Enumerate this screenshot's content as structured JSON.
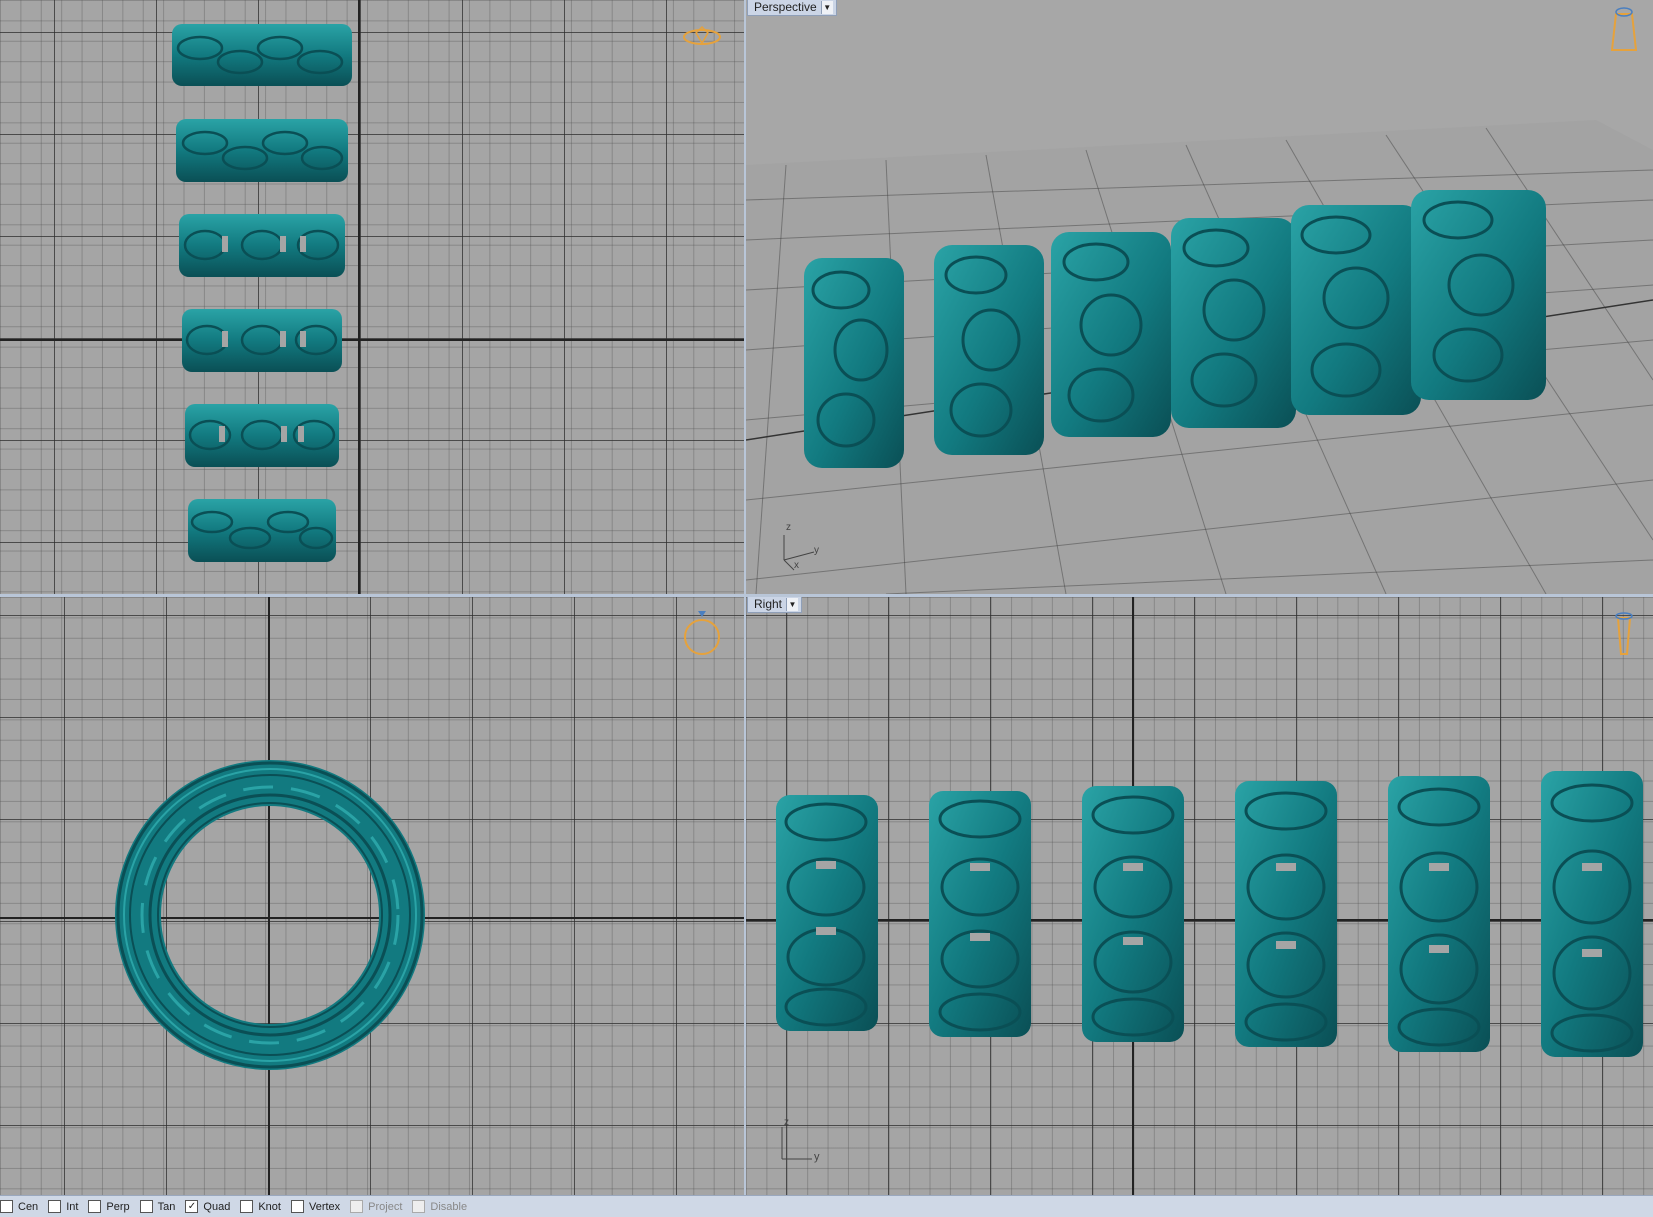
{
  "viewports": {
    "top": {
      "label": ""
    },
    "perspective": {
      "label": "Perspective"
    },
    "front": {
      "label": ""
    },
    "right": {
      "label": "Right"
    }
  },
  "axes": {
    "perspective": {
      "z": "z",
      "y": "y",
      "x": "x"
    },
    "right": {
      "z": "z",
      "y": "y"
    }
  },
  "osnap": [
    {
      "label": "Cen",
      "checked": false,
      "enabled": true
    },
    {
      "label": "Int",
      "checked": false,
      "enabled": true
    },
    {
      "label": "Perp",
      "checked": false,
      "enabled": true
    },
    {
      "label": "Tan",
      "checked": false,
      "enabled": true
    },
    {
      "label": "Quad",
      "checked": true,
      "enabled": true
    },
    {
      "label": "Knot",
      "checked": false,
      "enabled": true
    },
    {
      "label": "Vertex",
      "checked": false,
      "enabled": true
    },
    {
      "label": "Project",
      "checked": false,
      "enabled": false
    },
    {
      "label": "Disable",
      "checked": false,
      "enabled": false
    }
  ],
  "colors": {
    "model": "#127a80",
    "model_dark": "#0a4f55",
    "model_light": "#2aa3a6",
    "nav_icon": "#e6a23c"
  }
}
